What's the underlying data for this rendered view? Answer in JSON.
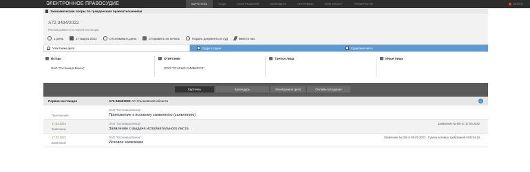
{
  "topbar": {
    "brand": "ЭЛЕКТРОННОЕ ПРАВОСУДИЕ",
    "nav": [
      "КАРТОТЕКА",
      "СУДЫ",
      "БАНК РЕШЕНИЙ",
      "КАЛЕНДАРЬ",
      "ПЕРЕРЫВЫ",
      "МОЙ АРБИТР",
      "ПРОВЕРКА ЭП"
    ],
    "active_nav": "КАРТОТЕКА",
    "login": "ВОЙТИ"
  },
  "category": "Экономические споры по гражданским правоотношениям",
  "case": {
    "number": "А72-3494/2022",
    "status": "Рассматривается в первой инстанции",
    "tools": {
      "duration": "1 день",
      "date": "17 марта 2022",
      "track": "Отслеживать дело",
      "print": "Отправить на печать",
      "submit": "Подать документы в суд",
      "sign": "Ввести пас"
    }
  },
  "tabs": {
    "participants": "Участники дела",
    "judges": "Суды и судьи",
    "acts": "Судебные акты"
  },
  "participants": {
    "plaintiffs": {
      "title": "Истцы",
      "value": "ОАО \"Гостиница Венец\""
    },
    "defendants": {
      "title": "Ответчики",
      "value": "ООО \"СТАРЫЙ СИМБИРСК\""
    },
    "third": {
      "title": "Третьи лица",
      "value": ""
    },
    "others": {
      "title": "Иные лица",
      "value": ""
    }
  },
  "filters": {
    "card": "Карточка",
    "calendar": "Календарь",
    "edelo": "Электронное дело",
    "online": "Онлайн-заседание"
  },
  "instance": {
    "label": "Первая инстанция",
    "case": "А72-3494/2022",
    "court": "АС Ульяновской области"
  },
  "documents": [
    {
      "date": "",
      "type": "Приложения",
      "who": "ОАО \"Гостиница Венец\"",
      "title": "Приложение к исковому заявлению (заявлению)",
      "note": ""
    },
    {
      "date": "17.03.2022",
      "type": "Заявление",
      "who": "ОАО \"Гостиница Венец\"",
      "title": "Заявление о выдаче исполнительного листа",
      "note": "Заявление № б/н от 17.03.2022"
    },
    {
      "date": "17.03.2022",
      "type": "Заявление",
      "who": "ОАО \"Гостиница Венец\"",
      "title": "Исковое заявление",
      "note": "Заявление №118 от 09.03.2022 , Сумма исковых требований 534154,14"
    }
  ]
}
